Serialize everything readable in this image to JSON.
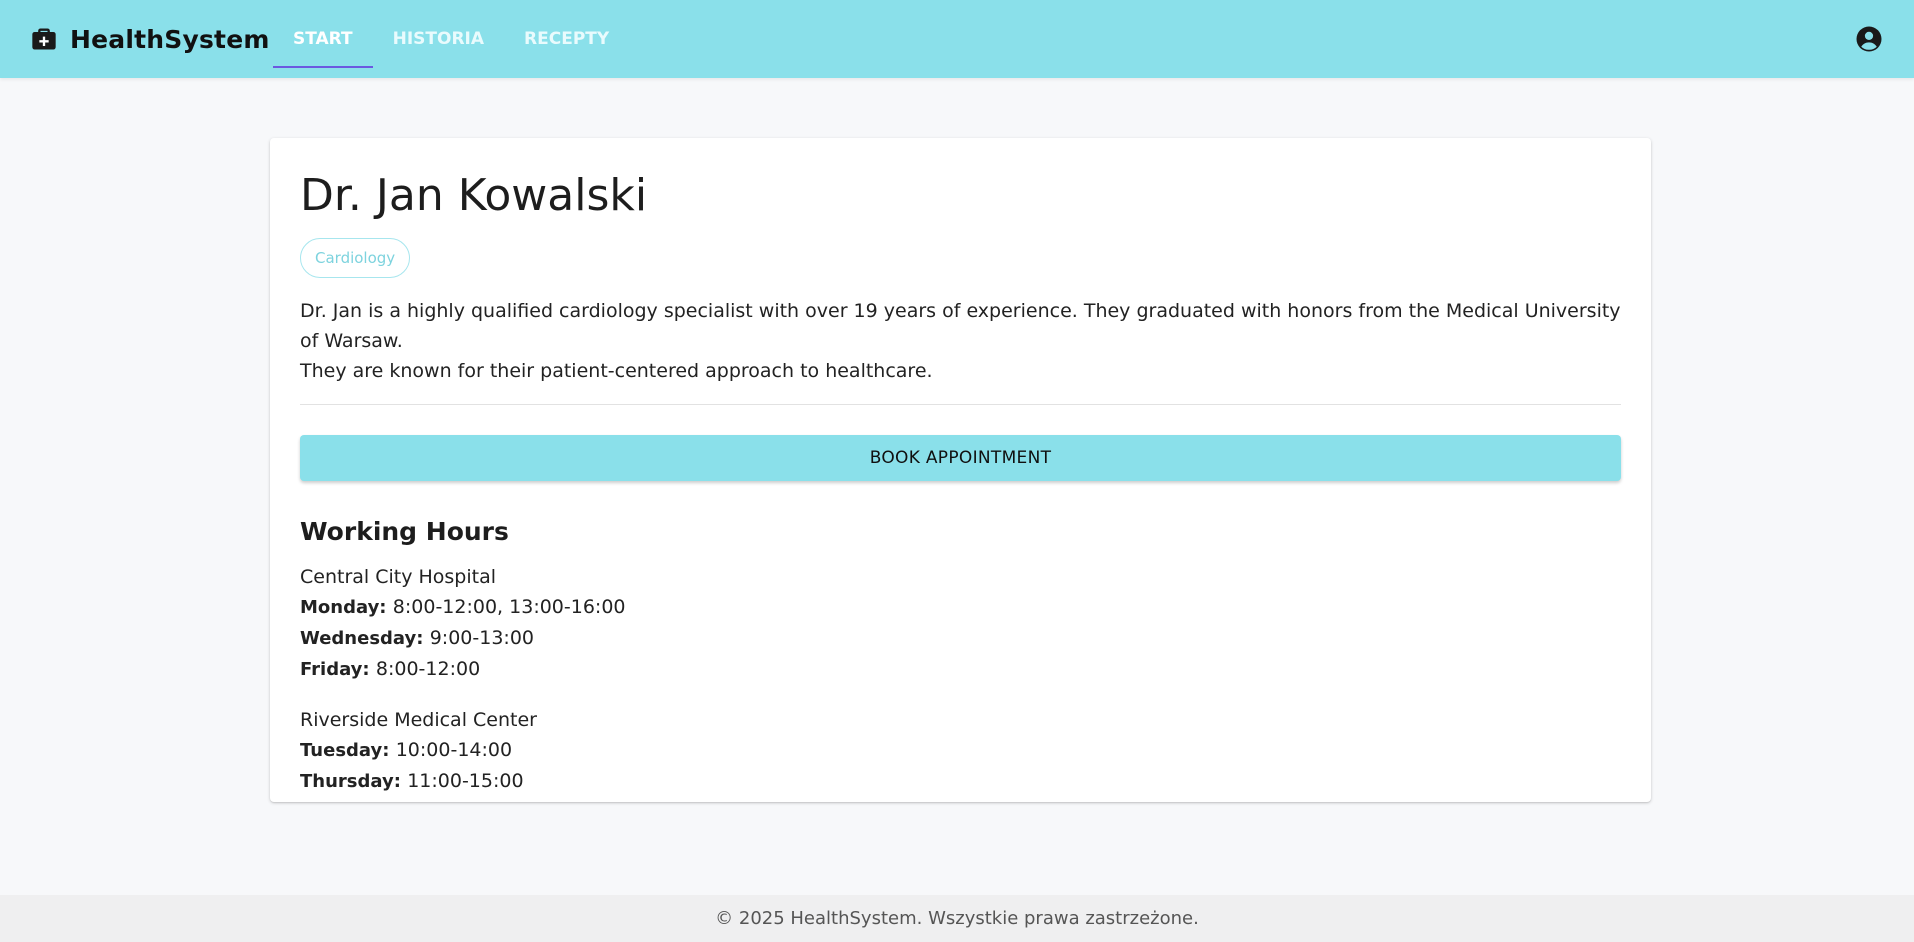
{
  "app": {
    "name": "HealthSystem",
    "logo_icon": "medical-bag-icon"
  },
  "nav": {
    "tabs": [
      {
        "label": "START",
        "active": true
      },
      {
        "label": "HISTORIA",
        "active": false
      },
      {
        "label": "RECEPTY",
        "active": false
      }
    ],
    "account_icon": "account-circle-icon"
  },
  "doctor": {
    "name": "Dr. Jan Kowalski",
    "specialty": "Cardiology",
    "bio_line1": "Dr. Jan is a highly qualified cardiology specialist with over 19 years of experience. They graduated with honors from the Medical University of Warsaw.",
    "bio_line2": "They are known for their patient-centered approach to healthcare."
  },
  "actions": {
    "book_label": "BOOK APPOINTMENT"
  },
  "working_hours": {
    "title": "Working Hours",
    "locations": [
      {
        "name": "Central City Hospital",
        "hours": [
          {
            "day": "Monday:",
            "time": "8:00-12:00, 13:00-16:00"
          },
          {
            "day": "Wednesday:",
            "time": "9:00-13:00"
          },
          {
            "day": "Friday:",
            "time": "8:00-12:00"
          }
        ]
      },
      {
        "name": "Riverside Medical Center",
        "hours": [
          {
            "day": "Tuesday:",
            "time": "10:00-14:00"
          },
          {
            "day": "Thursday:",
            "time": "11:00-15:00"
          }
        ]
      }
    ]
  },
  "footer": {
    "text": "© 2025 HealthSystem. Wszystkie prawa zastrzeżone."
  },
  "colors": {
    "header_bg": "#8ae0ea",
    "tab_indicator": "#6b59e0",
    "chip_border": "#a7e6ee",
    "page_bg": "#f7f8fa"
  }
}
